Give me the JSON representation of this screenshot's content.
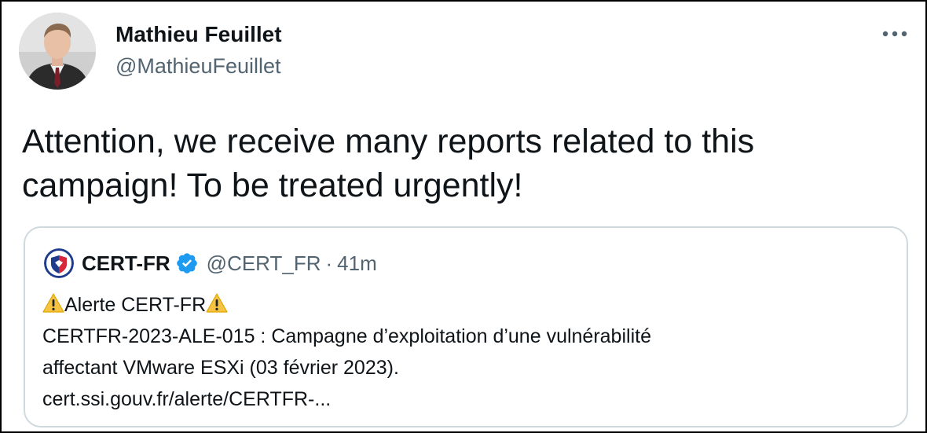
{
  "author": {
    "name": "Mathieu Feuillet",
    "handle": "@MathieuFeuillet",
    "avatar_icon": "person-photo-avatar"
  },
  "more_icon": "more-horizontal-icon",
  "tweet": {
    "text": "Attention, we receive many reports related to this campaign! To be treated urgently!"
  },
  "quote": {
    "name": "CERT-FR",
    "handle": "@CERT_FR",
    "separator": "·",
    "time": "41m",
    "logo_icon": "cert-fr-logo",
    "verified_icon": "verified-badge-icon",
    "verified_color": "#1d9bf0",
    "alert_title": "Alerte CERT-FR",
    "warning_icon": "warning-icon",
    "body_line1": "CERTFR-2023-ALE-015 : Campagne d’exploitation d’une vulnérabilité",
    "body_line2": "affectant VMware ESXi (03 février 2023).",
    "link": "cert.ssi.gouv.fr/alerte/CERTFR-..."
  },
  "colors": {
    "text_primary": "#0f1419",
    "text_secondary": "#536471",
    "card_border": "#cfd9de"
  }
}
